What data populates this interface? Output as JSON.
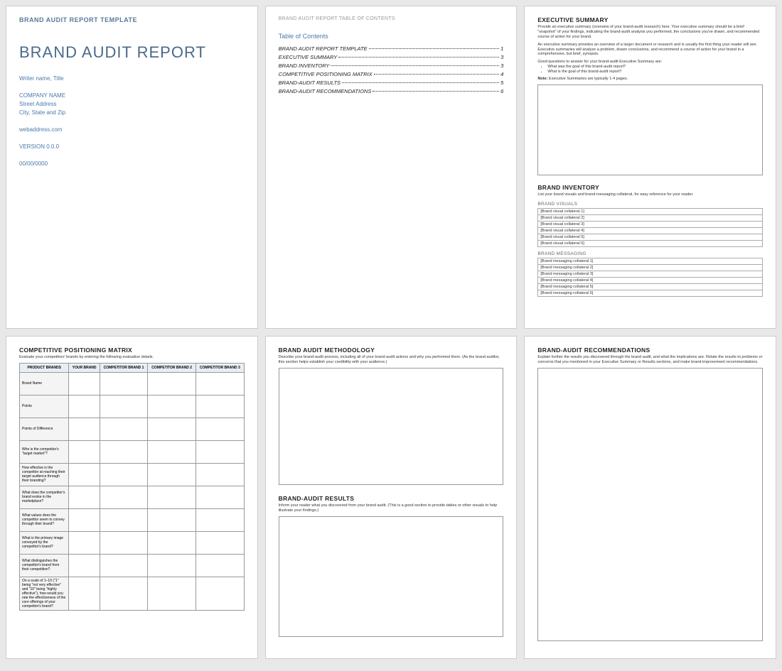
{
  "cover": {
    "subheader": "BRAND AUDIT REPORT TEMPLATE",
    "title": "BRAND AUDIT REPORT",
    "writer": "Writer name, Title",
    "company": "COMPANY NAME",
    "street": "Street Address",
    "citystate": "City, State and Zip",
    "web": "webaddress.com",
    "version": "VERSION 0.0.0",
    "date": "00/00/0000"
  },
  "toc": {
    "header": "BRAND AUDIT REPORT TABLE OF CONTENTS",
    "title": "Table of Contents",
    "rows": [
      {
        "label": "BRAND AUDIT REPORT TEMPLATE",
        "page": "1"
      },
      {
        "label": "EXECUTIVE SUMMARY",
        "page": "3"
      },
      {
        "label": "BRAND INVENTORY",
        "page": "3"
      },
      {
        "label": "COMPETITIVE POSITIONING MATRIX",
        "page": "4"
      },
      {
        "label": "BRAND-AUDIT RESULTS",
        "page": "5"
      },
      {
        "label": "BRAND-AUDIT RECOMMENDATIONS",
        "page": "6"
      }
    ]
  },
  "exec": {
    "title": "EXECUTIVE SUMMARY",
    "desc1": "Provide an executive summary (overview of your brand-audit research) here. Your executive summary should be a brief \"snapshot\" of your findings, indicating the brand-audit analysis you performed, the conclusions you've drawn, and recommended course of action for your brand.",
    "desc2": "An executive summary provides an overview of a larger document or research and is usually the first thing your reader will see.  Executive summaries will analyze a problem, drawn conclusions, and recommend a course of action for your brand in a comprehensive, but brief, synopsis.",
    "desc3": "Good questions to answer for your brand-audit Executive Summary are:",
    "bullets": [
      "What was the goal of this brand-audit report?",
      "What is the goal of this brand-audit report?"
    ],
    "note_label": "Note:",
    "note_text": "Executive Summaries are typically 1-4 pages."
  },
  "inventory": {
    "title": "BRAND INVENTORY",
    "desc": "List your brand visuals and brand-messaging collateral, for easy reference for your reader.",
    "visuals_title": "BRAND VISUALS",
    "visuals": [
      "[Brand visual collateral 1]",
      "[Brand visual collateral 2]",
      "[Brand visual collateral 3]",
      "[Brand visual collateral 4]",
      "[Brand visual collateral 5]",
      "[Brand visual collateral 6]"
    ],
    "messaging_title": "BRAND MESSAGING",
    "messaging": [
      "[Brand messaging collateral 1]",
      "[Brand messaging collateral 2]",
      "[Brand messaging collateral 3]",
      "[Brand messaging collateral 4]",
      "[Brand messaging collateral 5]",
      "[Brand messaging collateral 6]"
    ]
  },
  "matrix": {
    "title": "COMPETITIVE POSITIONING MATRIX",
    "desc": "Evaluate your competitors' brands by entering the following evaluative details.",
    "headers": [
      "PRODUCT BRANDS",
      "YOUR BRAND",
      "COMPETITOR BRAND 1",
      "COMPETITOR BRAND 2",
      "COMPETITOR BRAND 3"
    ],
    "rows": [
      "Brand Name",
      "Points",
      "Points of Difference",
      "Who is the competitor's \"target market\"?",
      "How effective is the competitor at reaching their target audience through their branding?",
      "What does the competitor's brand evoke in the marketplace?",
      "What values does the competitor seem to convey through their brand?",
      "What is the primary image conveyed by the competitor's brand?",
      "What distinguishes the competitor's brand from their competition?",
      "On a scale of 1–10 (\"1\" being \"not very effective\" and \"10\" being \"highly effective\"), how would you rate the effectiveness of the core offerings of your competitor's brand?"
    ]
  },
  "methodology": {
    "title": "BRAND AUDIT METHODOLOGY",
    "desc": "Describe your brand-audit process, including all of your brand-audit actions and why you performed them. (As the brand auditor, this section helps establish your credibility with your audience.)"
  },
  "results": {
    "title": "BRAND-AUDIT RESULTS",
    "desc": "Inform your reader what you discovered from your brand audit. (This is a good section to provide tables or other visuals to help illustrate your findings.)"
  },
  "recs": {
    "title": "BRAND-AUDIT RECOMMENDATIONS",
    "desc": "Explain further the results you discovered through the brand audit, and what the implications are. Relate the results to problems or concerns that you mentioned in your Executive Summary or Results sections, and make brand-improvement recommendations."
  }
}
